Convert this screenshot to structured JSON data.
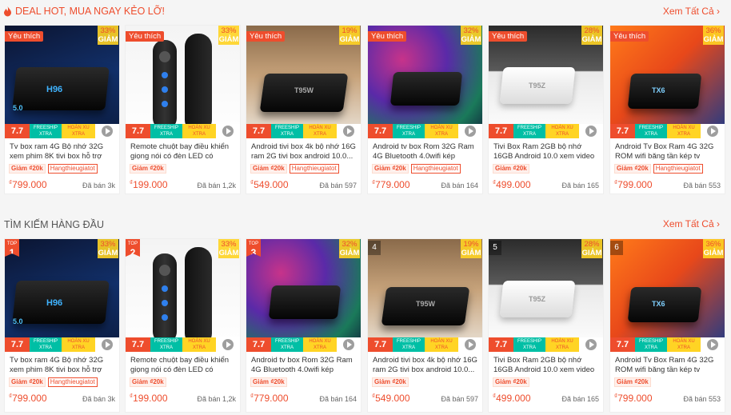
{
  "colors": {
    "accent": "#ee4d2d",
    "discount_badge": "#ffd424",
    "freeship": "#00bfa5"
  },
  "sections": [
    {
      "title": "DEAL HOT, MUA NGAY KẺO LỠ!",
      "see_all": "Xem Tất Cả",
      "icon": "flame-icon",
      "products": [
        {
          "badge": "Yêu thích",
          "discount_pct": "33%",
          "discount_label": "GIẢM",
          "name": "Tv box ram 4G Bộ nhớ 32G xem phim 8K tivi box hỗ trợ tìm kiế...",
          "promo": "Giảm ₫20k",
          "shop": "Hangthieugiatot",
          "currency": "₫",
          "price": "799.000",
          "sold": "Đã bán 3k",
          "img": "dark"
        },
        {
          "badge": "Yêu thích",
          "discount_pct": "33%",
          "discount_label": "GIẢM",
          "name": "Remote chuột bay điều khiển giọng nói có đèn LED có phím...",
          "promo": "Giảm ₫20k",
          "shop": "",
          "currency": "₫",
          "price": "199.000",
          "sold": "Đã bán 1,2k",
          "img": "remote"
        },
        {
          "badge": "Yêu thích",
          "discount_pct": "19%",
          "discount_label": "GIẢM",
          "name": "Android tivi box 4k bộ nhớ 16G ram 2G tivi box android 10.0...",
          "promo": "Giảm ₫20k",
          "shop": "Hangthieugiatot",
          "currency": "₫",
          "price": "549.000",
          "sold": "Đã bán 597",
          "img": "room"
        },
        {
          "badge": "Yêu thích",
          "discount_pct": "32%",
          "discount_label": "GIẢM",
          "name": "Android tv box Rom 32G Ram 4G Bluetooth 4.0wifi kép andr...",
          "promo": "Giảm ₫20k",
          "shop": "Hangthieugiatot",
          "currency": "₫",
          "price": "779.000",
          "sold": "Đã bán 164",
          "img": "colorful"
        },
        {
          "badge": "Yêu thích",
          "discount_pct": "28%",
          "discount_label": "GIẢM",
          "name": "Tivi Box Ram 2GB bộ nhớ 16GB Android 10.0 xem video 4K thi...",
          "promo": "Giảm ₫20k",
          "shop": "",
          "currency": "₫",
          "price": "499.000",
          "sold": "Đã bán 165",
          "img": "tv"
        },
        {
          "badge": "Yêu thích",
          "discount_pct": "36%",
          "discount_label": "GIẢM",
          "name": "Android Tv Box Ram 4G 32G ROM wifi băng tần kép tv box...",
          "promo": "Giảm ₫20k",
          "shop": "Hangthieugiatot",
          "currency": "₫",
          "price": "799.000",
          "sold": "Đã bán 553",
          "img": "orange"
        }
      ]
    },
    {
      "title": "TÌM KIẾM HÀNG ĐẦU",
      "see_all": "Xem Tất Cả",
      "products": [
        {
          "rank_top": "TOP",
          "rank": "1",
          "discount_pct": "33%",
          "discount_label": "GIẢM",
          "name": "Tv box ram 4G Bộ nhớ 32G xem phim 8K tivi box hỗ trợ tìm kiế...",
          "promo": "Giảm ₫20k",
          "shop": "Hangthieugiatot",
          "currency": "₫",
          "price": "799.000",
          "sold": "Đã bán 3k",
          "img": "dark"
        },
        {
          "rank_top": "TOP",
          "rank": "2",
          "discount_pct": "33%",
          "discount_label": "GIẢM",
          "name": "Remote chuột bay điều khiển giọng nói có đèn LED có phím...",
          "promo": "Giảm ₫20k",
          "shop": "",
          "currency": "₫",
          "price": "199.000",
          "sold": "Đã bán 1,2k",
          "img": "remote"
        },
        {
          "rank_top": "TOP",
          "rank": "3",
          "discount_pct": "32%",
          "discount_label": "GIẢM",
          "name": "Android tv box Rom 32G Ram 4G Bluetooth 4.0wifi kép andr...",
          "promo": "Giảm ₫20k",
          "shop": "",
          "currency": "₫",
          "price": "779.000",
          "sold": "Đã bán 164",
          "img": "colorful"
        },
        {
          "rank_top": "",
          "rank": "4",
          "discount_pct": "19%",
          "discount_label": "GIẢM",
          "name": "Android tivi box 4k bộ nhớ 16G ram 2G tivi box android 10.0...",
          "promo": "Giảm ₫20k",
          "shop": "",
          "currency": "₫",
          "price": "549.000",
          "sold": "Đã bán 597",
          "img": "room"
        },
        {
          "rank_top": "",
          "rank": "5",
          "discount_pct": "28%",
          "discount_label": "GIẢM",
          "name": "Tivi Box Ram 2GB bộ nhớ 16GB Android 10.0 xem video 4K thi...",
          "promo": "Giảm ₫20k",
          "shop": "",
          "currency": "₫",
          "price": "499.000",
          "sold": "Đã bán 165",
          "img": "tv"
        },
        {
          "rank_top": "",
          "rank": "6",
          "discount_pct": "36%",
          "discount_label": "GIẢM",
          "name": "Android Tv Box Ram 4G 32G ROM wifi băng tần kép tv box...",
          "promo": "Giảm ₫20k",
          "shop": "",
          "currency": "₫",
          "price": "799.000",
          "sold": "Đã bán 553",
          "img": "orange"
        }
      ]
    }
  ],
  "promo_strip": {
    "sale_label": "7.7",
    "freeship": "FREESHIP XTRA",
    "cashback": "HOÀN XU XTRA"
  }
}
